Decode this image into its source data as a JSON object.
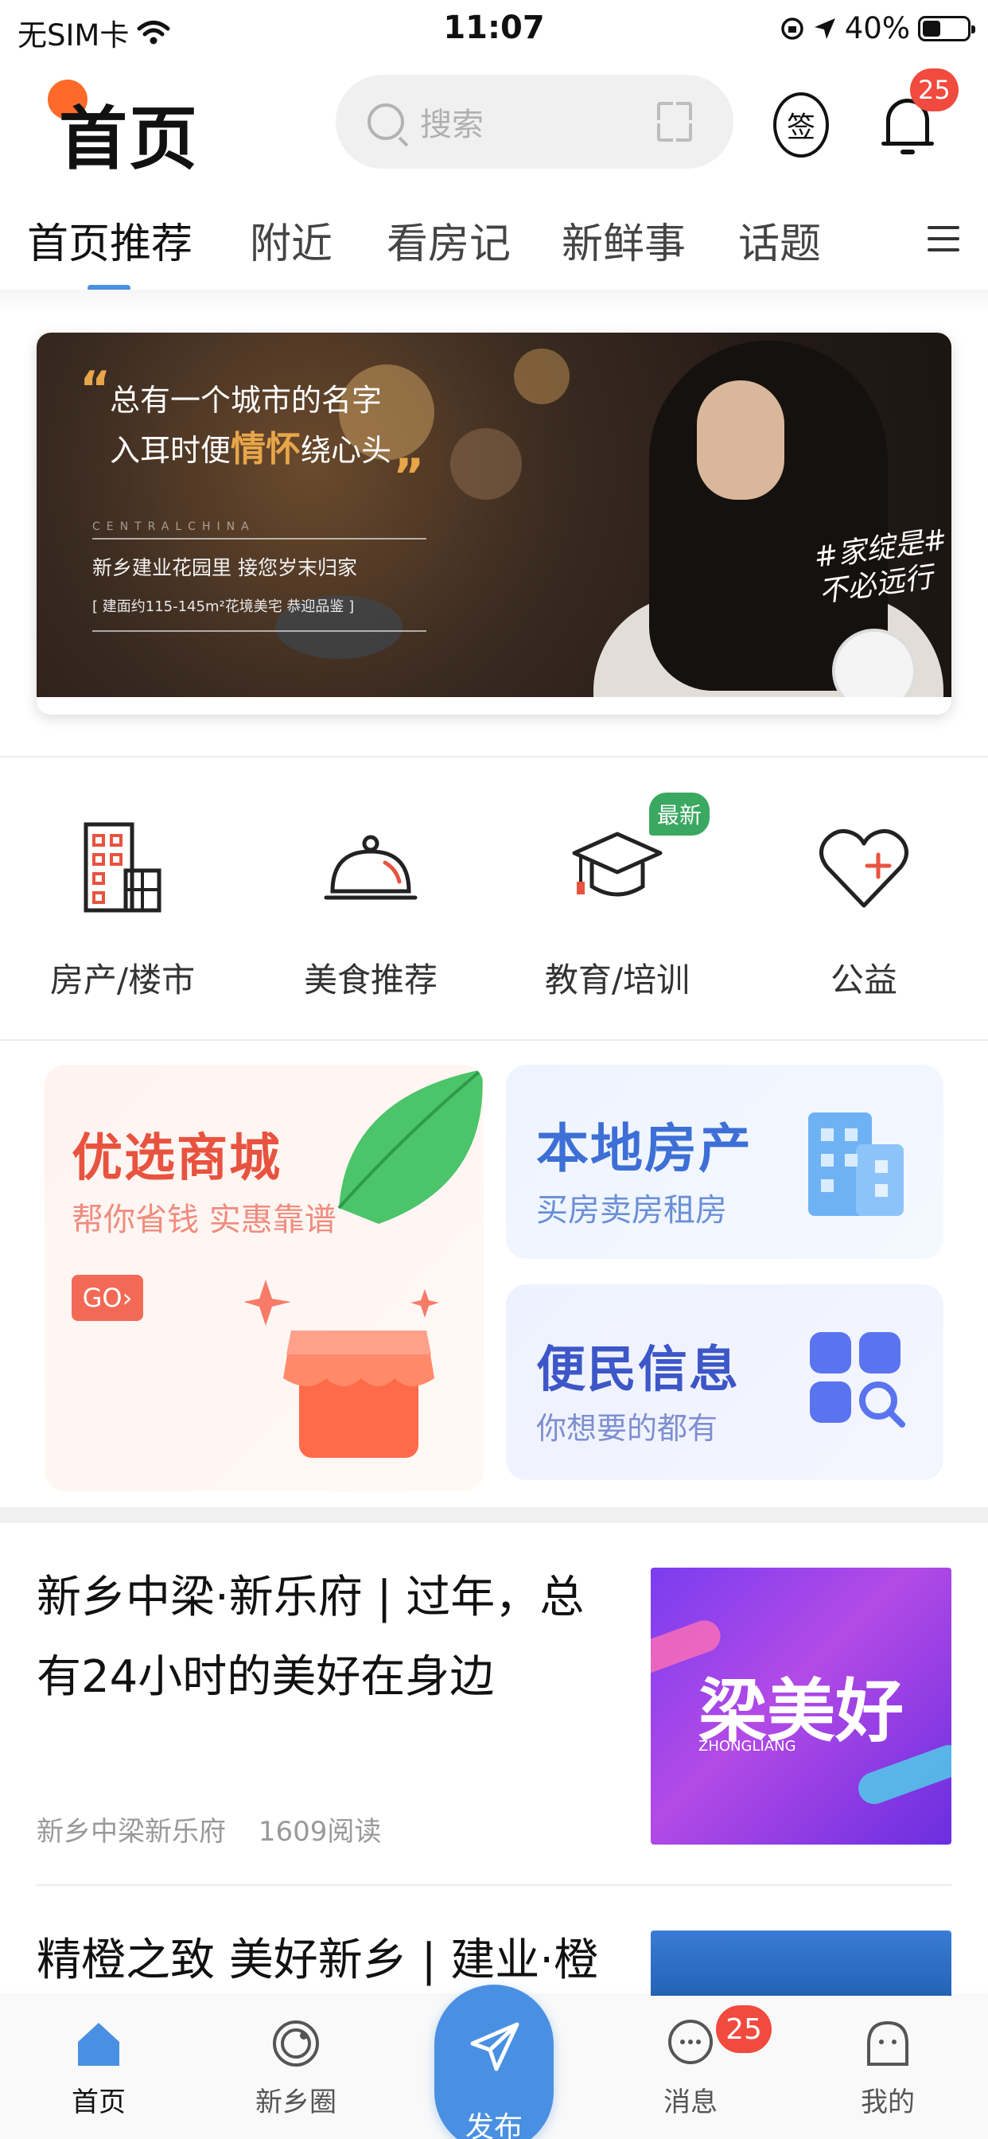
{
  "status_bar": {
    "carrier": "无SIM卡",
    "time": "11:07",
    "battery": "40%"
  },
  "header": {
    "title": "首页",
    "search_placeholder": "搜索",
    "sign_label": "签",
    "notification_count": "25"
  },
  "tabs": [
    {
      "label": "首页推荐",
      "active": true
    },
    {
      "label": "附近",
      "active": false
    },
    {
      "label": "看房记",
      "active": false
    },
    {
      "label": "新鲜事",
      "active": false
    },
    {
      "label": "话题",
      "active": false
    }
  ],
  "banner": {
    "quote_line1": "总有一个城市的名字",
    "quote_line2_pre": "入耳时便",
    "quote_line2_highlight": "情怀",
    "quote_line2_post": "绕心头",
    "english": "CENTRALCHINA",
    "subtitle": "新乡建业花园里  接您岁末归家",
    "small_text": "[ 建面约115-145m²花境美宅 恭迎品鉴 ]",
    "slogan_line1": "#家绽是#",
    "slogan_line2": "不必远行"
  },
  "categories": [
    {
      "label": "房产/楼市",
      "icon": "building-icon"
    },
    {
      "label": "美食推荐",
      "icon": "food-cloche-icon"
    },
    {
      "label": "教育/培训",
      "icon": "graduation-cap-icon",
      "badge": "最新"
    },
    {
      "label": "公益",
      "icon": "heart-plus-icon"
    }
  ],
  "promo_cards": {
    "mall": {
      "title": "优选商城",
      "subtitle": "帮你省钱 实惠靠谱",
      "cta": "GO›"
    },
    "real_estate": {
      "title": "本地房产",
      "subtitle": "买房卖房租房"
    },
    "info": {
      "title": "便民信息",
      "subtitle": "你想要的都有"
    }
  },
  "articles": [
    {
      "title": "新乡中梁·新乐府 | 过年，总有24小时的美好在身边",
      "source": "新乡中梁新乐府",
      "reads": "1609阅读",
      "thumb_text": "梁美好",
      "thumb_sub": "ZHONGLIANG"
    },
    {
      "title": "精橙之致 美好新乡 | 建业·橙",
      "source": "",
      "reads": ""
    }
  ],
  "bottom_nav": [
    {
      "label": "首页",
      "icon": "home-icon",
      "active": true
    },
    {
      "label": "新乡圈",
      "icon": "circle-icon",
      "active": false
    },
    {
      "label": "发布",
      "icon": "send-icon",
      "active": false
    },
    {
      "label": "消息",
      "icon": "message-icon",
      "active": false,
      "badge": "25"
    },
    {
      "label": "我的",
      "icon": "profile-icon",
      "active": false
    }
  ],
  "colors": {
    "accent": "#4a90e2",
    "badge_red": "#f14a3e",
    "mall_red": "#e8533f",
    "estate_blue": "#3d6fd6",
    "new_green": "#3aa860"
  }
}
